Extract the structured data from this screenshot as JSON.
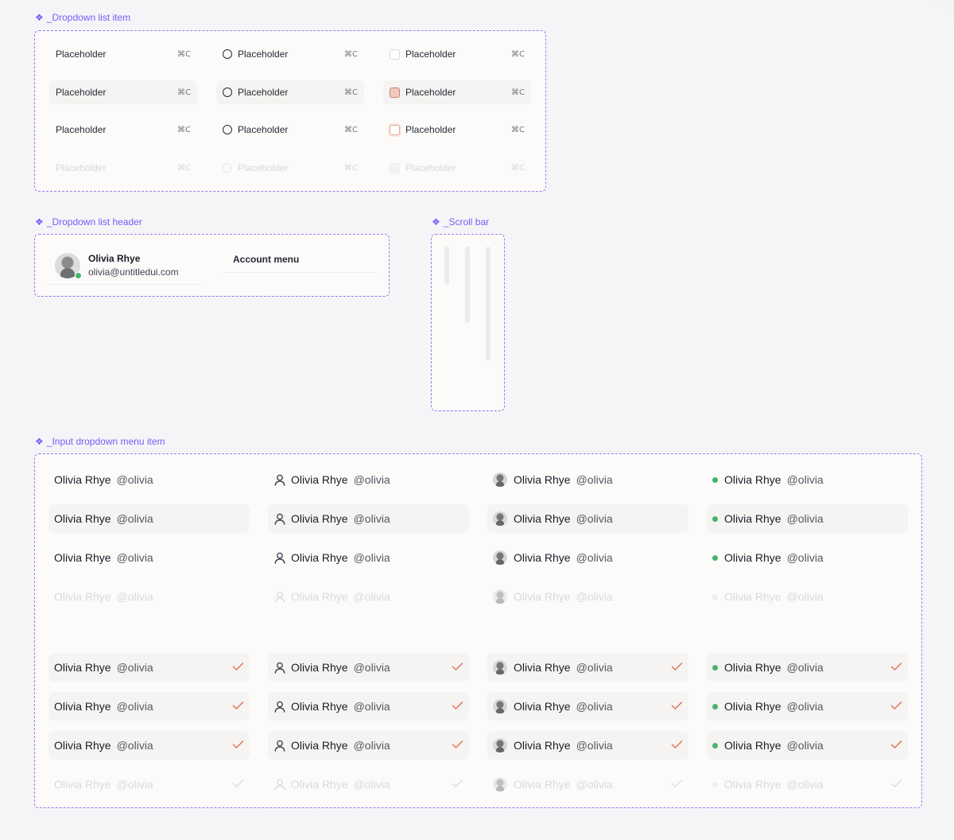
{
  "sections": {
    "dropdown_list_item": "_Dropdown list item",
    "dropdown_list_header": "_Dropdown list header",
    "scroll_bar": "_Scroll bar",
    "input_dropdown_menu_item": "_Input dropdown menu item"
  },
  "dropdown_items": {
    "label": "Placeholder",
    "shortcut": "⌘C"
  },
  "header": {
    "name": "Olivia Rhye",
    "email": "olivia@untitledui.com",
    "menu_title": "Account menu"
  },
  "input_items": {
    "name": "Olivia Rhye",
    "handle": "@olivia"
  },
  "icons": {
    "section": "component-diamond-icon",
    "radio": "radio-icon",
    "checkbox": "checkbox-icon",
    "user": "user-icon",
    "avatar": "avatar-icon",
    "status": "status-dot-icon",
    "check": "check-icon"
  },
  "colors": {
    "accent": "#7a5af8",
    "check": "#e0795e",
    "online": "#47b26b"
  }
}
